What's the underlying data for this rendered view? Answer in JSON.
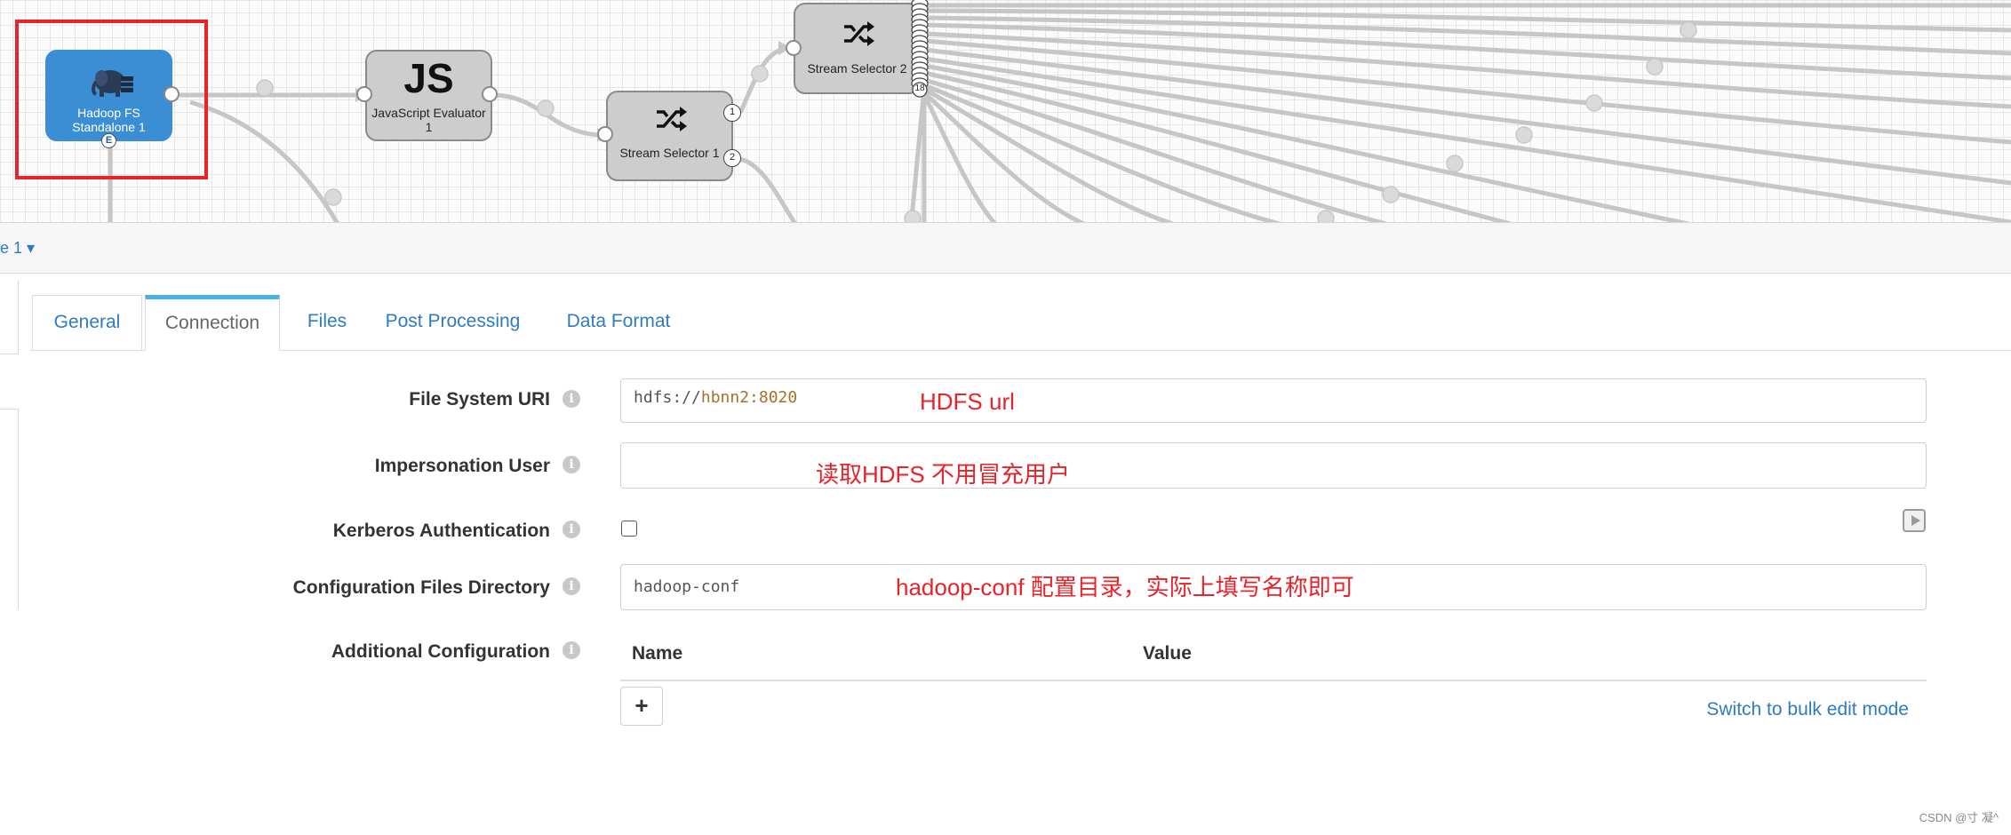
{
  "canvas": {
    "nodes": {
      "hdfs": {
        "title": "Hadoop FS Standalone 1",
        "error_port": "E",
        "icon": "hadoop-elephant-icon"
      },
      "js": {
        "icon_text": "JS",
        "title": "JavaScript Evaluator 1"
      },
      "selector1": {
        "title": "Stream Selector 1",
        "ports": [
          "1",
          "2"
        ],
        "icon": "shuffle-icon"
      },
      "selector2": {
        "title": "Stream Selector 2",
        "last_port": "18",
        "icon": "shuffle-icon"
      }
    },
    "selection_color": "#e8232a"
  },
  "stage_bar": {
    "label": "e 1 ▾"
  },
  "tabs": [
    "General",
    "Connection",
    "Files",
    "Post Processing",
    "Data Format"
  ],
  "active_tab": "Connection",
  "form": {
    "fs_uri": {
      "label": "File System URI",
      "value_scheme": "hdfs://",
      "value_rest": "hbnn2:8020",
      "annotation": "HDFS url"
    },
    "impersonation": {
      "label": "Impersonation User",
      "value": "",
      "annotation": "读取HDFS 不用冒充用户"
    },
    "kerberos": {
      "label": "Kerberos Authentication",
      "checked": false
    },
    "config_dir": {
      "label": "Configuration Files Directory",
      "value": "hadoop-conf",
      "annotation": "hadoop-conf 配置目录，实际上填写名称即可"
    },
    "additional": {
      "label": "Additional Configuration",
      "col_name": "Name",
      "col_value": "Value",
      "add_label": "+",
      "bulk_link": "Switch to bulk edit mode"
    }
  },
  "watermark": "CSDN @寸 凝^",
  "colors": {
    "accent": "#2f7bc0",
    "selected_node": "#3b8ed4",
    "annotation": "#e8232a",
    "active_tab_bar": "#47b3e2"
  }
}
